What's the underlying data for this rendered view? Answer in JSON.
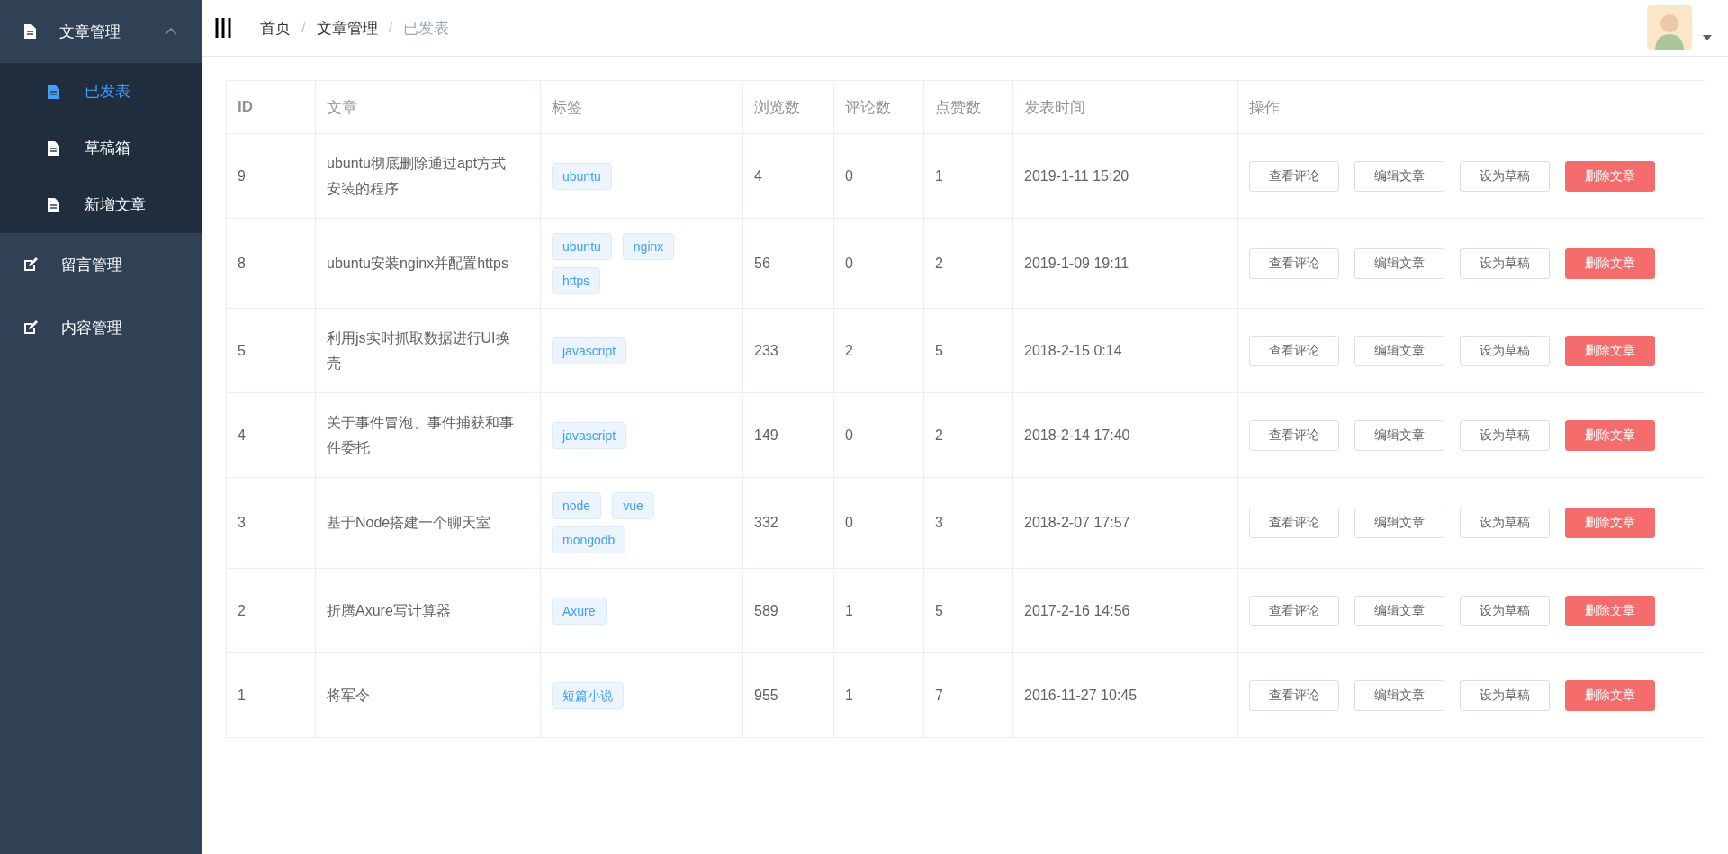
{
  "sidebar": {
    "items": [
      {
        "label": "文章管理",
        "expanded": true,
        "children": [
          {
            "label": "已发表",
            "selected": true
          },
          {
            "label": "草稿箱",
            "selected": false
          },
          {
            "label": "新增文章",
            "selected": false
          }
        ]
      },
      {
        "label": "留言管理",
        "expanded": false
      },
      {
        "label": "内容管理",
        "expanded": false
      }
    ]
  },
  "header": {
    "breadcrumb": [
      "首页",
      "文章管理",
      "已发表"
    ],
    "separator": "/"
  },
  "table": {
    "columns": [
      "ID",
      "文章",
      "标签",
      "浏览数",
      "评论数",
      "点赞数",
      "发表时间",
      "操作"
    ],
    "rows": [
      {
        "id": "9",
        "title": "ubuntu彻底删除通过apt方式安装的程序",
        "tags": [
          "ubuntu"
        ],
        "views": "4",
        "comments": "0",
        "likes": "1",
        "time": "2019-1-11 15:20",
        "actions": [
          {
            "label": "查看评论",
            "kind": "default"
          },
          {
            "label": "编辑文章",
            "kind": "default"
          },
          {
            "label": "设为草稿",
            "kind": "default"
          },
          {
            "label": "删除文章",
            "kind": "danger"
          }
        ]
      },
      {
        "id": "8",
        "title": "ubuntu安装nginx并配置https",
        "tags": [
          "ubuntu",
          "nginx",
          "https"
        ],
        "views": "56",
        "comments": "0",
        "likes": "2",
        "time": "2019-1-09 19:11",
        "actions": [
          {
            "label": "查看评论",
            "kind": "default"
          },
          {
            "label": "编辑文章",
            "kind": "default"
          },
          {
            "label": "设为草稿",
            "kind": "default"
          },
          {
            "label": "删除文章",
            "kind": "danger"
          }
        ]
      },
      {
        "id": "5",
        "title": "利用js实时抓取数据进行UI换壳",
        "tags": [
          "javascript"
        ],
        "views": "233",
        "comments": "2",
        "likes": "5",
        "time": "2018-2-15 0:14",
        "actions": [
          {
            "label": "查看评论",
            "kind": "default"
          },
          {
            "label": "编辑文章",
            "kind": "default"
          },
          {
            "label": "设为草稿",
            "kind": "default"
          },
          {
            "label": "删除文章",
            "kind": "danger"
          }
        ]
      },
      {
        "id": "4",
        "title": "关于事件冒泡、事件捕获和事件委托",
        "tags": [
          "javascript"
        ],
        "views": "149",
        "comments": "0",
        "likes": "2",
        "time": "2018-2-14 17:40",
        "actions": [
          {
            "label": "查看评论",
            "kind": "default"
          },
          {
            "label": "编辑文章",
            "kind": "default"
          },
          {
            "label": "设为草稿",
            "kind": "default"
          },
          {
            "label": "删除文章",
            "kind": "danger"
          }
        ]
      },
      {
        "id": "3",
        "title": "基于Node搭建一个聊天室",
        "tags": [
          "node",
          "vue",
          "mongodb"
        ],
        "views": "332",
        "comments": "0",
        "likes": "3",
        "time": "2018-2-07 17:57",
        "actions": [
          {
            "label": "查看评论",
            "kind": "default"
          },
          {
            "label": "编辑文章",
            "kind": "default"
          },
          {
            "label": "设为草稿",
            "kind": "default"
          },
          {
            "label": "删除文章",
            "kind": "danger"
          }
        ]
      },
      {
        "id": "2",
        "title": "折腾Axure写计算器",
        "tags": [
          "Axure"
        ],
        "views": "589",
        "comments": "1",
        "likes": "5",
        "time": "2017-2-16 14:56",
        "actions": [
          {
            "label": "查看评论",
            "kind": "default"
          },
          {
            "label": "编辑文章",
            "kind": "default"
          },
          {
            "label": "设为草稿",
            "kind": "default"
          },
          {
            "label": "删除文章",
            "kind": "danger"
          }
        ]
      },
      {
        "id": "1",
        "title": "将军令",
        "tags": [
          "短篇小说"
        ],
        "views": "955",
        "comments": "1",
        "likes": "7",
        "time": "2016-11-27 10:45",
        "actions": [
          {
            "label": "查看评论",
            "kind": "default"
          },
          {
            "label": "编辑文章",
            "kind": "default"
          },
          {
            "label": "设为草稿",
            "kind": "default"
          },
          {
            "label": "删除文章",
            "kind": "danger"
          }
        ]
      }
    ]
  }
}
